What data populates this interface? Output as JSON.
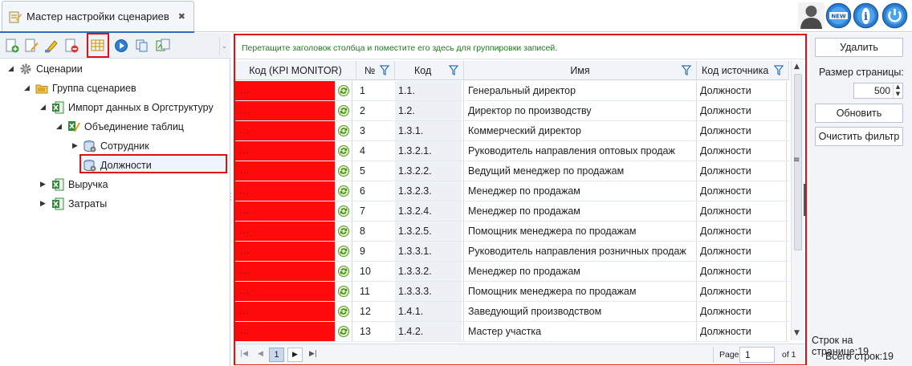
{
  "window": {
    "tab_title": "Мастер настройки сценариев",
    "tab_close": "✖",
    "top_icons": [
      "user-icon",
      "new-icon",
      "info-icon",
      "power-icon"
    ]
  },
  "tree": {
    "toolbar_icons": [
      "new-scenario-icon",
      "edit-icon",
      "rename-icon",
      "delete-icon",
      "table-settings-icon",
      "run-icon",
      "copy-icon",
      "export-icon"
    ],
    "nodes": [
      {
        "label": "Сценарии",
        "arrow": "◢",
        "icon": "gear-icon"
      },
      {
        "label": "Группа сценариев",
        "arrow": "◢",
        "icon": "folder-icon"
      },
      {
        "label": "Импорт данных в Оргструктуру",
        "arrow": "◢",
        "icon": "excel-icon"
      },
      {
        "label": "Объединение таблиц",
        "arrow": "◢",
        "icon": "merge-icon"
      },
      {
        "label": "Сотрудник",
        "arrow": "▶",
        "icon": "database-icon"
      },
      {
        "label": "Должности",
        "arrow": "",
        "icon": "database-icon"
      },
      {
        "label": "Выручка",
        "arrow": "▶",
        "icon": "excel-icon"
      },
      {
        "label": "Затраты",
        "arrow": "▶",
        "icon": "excel-icon"
      }
    ]
  },
  "grid": {
    "group_hint": "Перетащите заголовок столбца и поместите его здесь для группировки записей.",
    "columns": {
      "kpi": "Код (KPI MONITOR)",
      "num": "№",
      "code": "Код",
      "name": "Имя",
      "source": "Код источника"
    },
    "kpi_placeholder": "...",
    "rows": [
      {
        "num": "1",
        "code": "1.1.",
        "name": "Генеральный директор",
        "source": "Должности"
      },
      {
        "num": "2",
        "code": "1.2.",
        "name": "Директор по производству",
        "source": "Должности"
      },
      {
        "num": "3",
        "code": "1.3.1.",
        "name": "Коммерческий директор",
        "source": "Должности"
      },
      {
        "num": "4",
        "code": "1.3.2.1.",
        "name": "Руководитель направления оптовых продаж",
        "source": "Должности"
      },
      {
        "num": "5",
        "code": "1.3.2.2.",
        "name": "Ведущий менеджер по продажам",
        "source": "Должности"
      },
      {
        "num": "6",
        "code": "1.3.2.3.",
        "name": "Менеджер по продажам",
        "source": "Должности"
      },
      {
        "num": "7",
        "code": "1.3.2.4.",
        "name": "Менеджер по продажам",
        "source": "Должности"
      },
      {
        "num": "8",
        "code": "1.3.2.5.",
        "name": "Помощник менеджера по продажам",
        "source": "Должности"
      },
      {
        "num": "9",
        "code": "1.3.3.1.",
        "name": "Руководитель направления розничных продаж",
        "source": "Должности"
      },
      {
        "num": "10",
        "code": "1.3.3.2.",
        "name": "Менеджер по продажам",
        "source": "Должности"
      },
      {
        "num": "11",
        "code": "1.3.3.3.",
        "name": "Помощник менеджера по продажам",
        "source": "Должности"
      },
      {
        "num": "12",
        "code": "1.4.1.",
        "name": "Заведующий производством",
        "source": "Должности"
      },
      {
        "num": "13",
        "code": "1.4.2.",
        "name": "Мастер участка",
        "source": "Должности"
      }
    ],
    "pager": {
      "first": "|◀",
      "prev": "◀",
      "current_page": "1",
      "next": "▶",
      "last": "▶|",
      "page_label": "Page",
      "page_value": "1",
      "of_label": "of 1"
    },
    "menu_glyph": "≡"
  },
  "right_panel": {
    "delete_label": "Удалить",
    "page_size_label": "Размер страницы:",
    "page_size_value": "500",
    "refresh_label": "Обновить",
    "clear_filter_label": "Очистить фильтр",
    "rows_on_page": "Строк на странице:19",
    "rows_total": "Всего строк:19"
  },
  "colors": {
    "highlight_red": "#e01010",
    "kpi_cell_red": "#ff0a0a",
    "group_hint_green": "#1f7a1f",
    "accent_blue": "#2c6fb7"
  }
}
